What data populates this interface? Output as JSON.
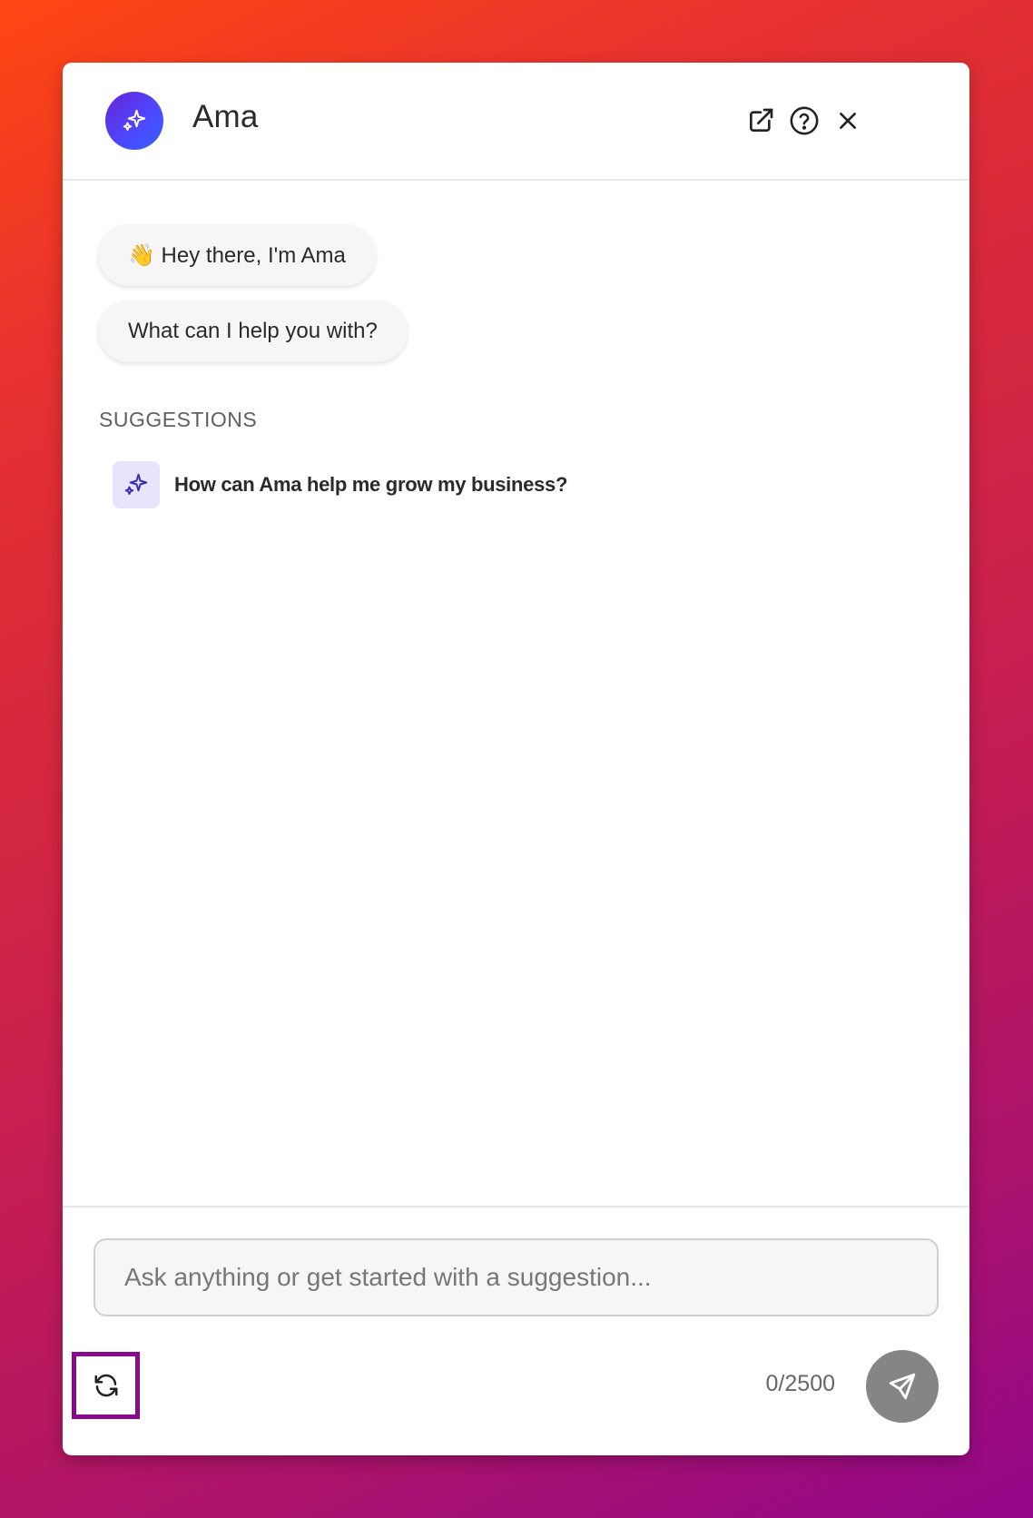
{
  "header": {
    "title": "Ama",
    "avatar_icon": "sparkles-icon",
    "actions": [
      {
        "name": "open-external-icon"
      },
      {
        "name": "help-icon"
      },
      {
        "name": "close-icon"
      }
    ]
  },
  "messages": [
    {
      "text": "👋 Hey there, I'm Ama"
    },
    {
      "text": "What can I help you with?"
    }
  ],
  "suggestions": {
    "label": "SUGGESTIONS",
    "items": [
      {
        "icon": "sparkles-icon",
        "text": "How can Ama help me grow my business?"
      }
    ]
  },
  "composer": {
    "placeholder": "Ask anything or get started with a suggestion...",
    "value": "",
    "counter": "0/2500",
    "refresh_icon": "refresh-icon",
    "send_icon": "send-icon"
  },
  "colors": {
    "accent": "#4b49ff",
    "highlight_border": "#8a0a8e",
    "send_button": "#858585"
  }
}
